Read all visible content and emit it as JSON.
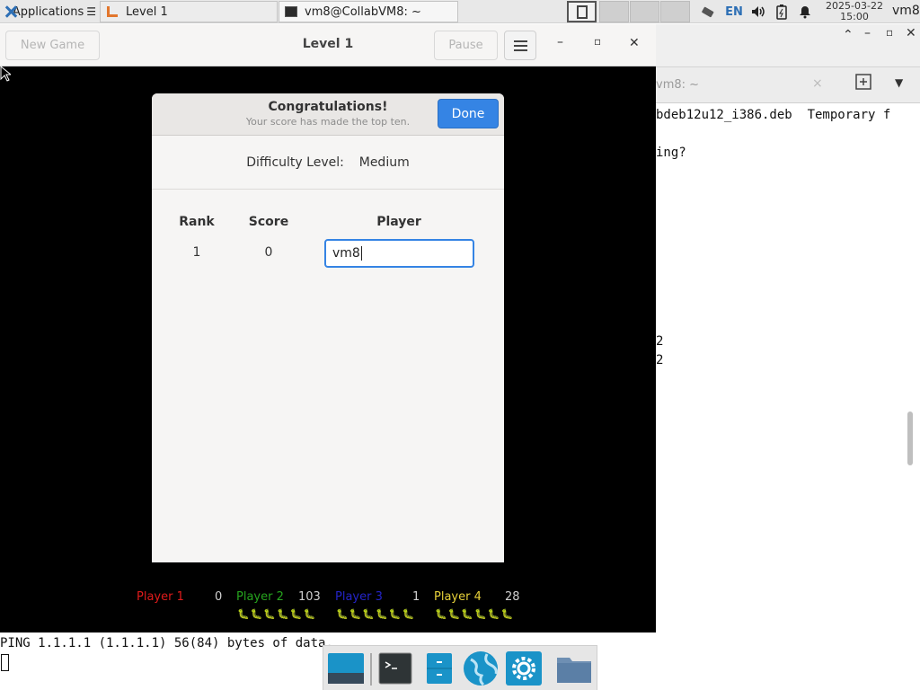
{
  "top_panel": {
    "apps_label": "Applications",
    "tasks": [
      {
        "label": "Level 1"
      },
      {
        "label": "vm8@CollabVM8: ~"
      }
    ],
    "lang": "EN",
    "clock_date": "2025-03-22",
    "clock_time": "15:00",
    "user": "vm8"
  },
  "terminal_window": {
    "tab_title": "vm8: ~",
    "lines": [
      "bdeb12u12_i386.deb  Temporary f",
      "ing?",
      "2",
      "2"
    ]
  },
  "game_window": {
    "title": "Level 1",
    "new_game_label": "New Game",
    "pause_label": "Pause",
    "dialog": {
      "title": "Congratulations!",
      "subtitle": "Your score has made the top ten.",
      "done_label": "Done",
      "difficulty_label": "Difficulty Level:",
      "difficulty_value": "Medium",
      "columns": [
        "Rank",
        "Score",
        "Player"
      ],
      "row": {
        "rank": "1",
        "score": "0",
        "player": "vm8"
      }
    },
    "scoreboard": [
      {
        "name": "Player 1",
        "score": "0",
        "color": "#e01b1b"
      },
      {
        "name": "Player 2",
        "score": "103",
        "color": "#26a41e"
      },
      {
        "name": "Player 3",
        "score": "1",
        "color": "#2424c8"
      },
      {
        "name": "Player 4",
        "score": "28",
        "color": "#e8d23a"
      }
    ]
  },
  "bottom_terminal": {
    "ping_line": "PING 1.1.1.1 (1.1.1.1) 56(84) bytes of data."
  },
  "dock": {
    "items": [
      "desktop-icon",
      "terminal-icon",
      "file-cabinet-icon",
      "web-browser-icon",
      "settings-icon",
      "folder-icon"
    ]
  },
  "colors": {
    "accent": "#3584e4",
    "game_bg": "#000000"
  }
}
